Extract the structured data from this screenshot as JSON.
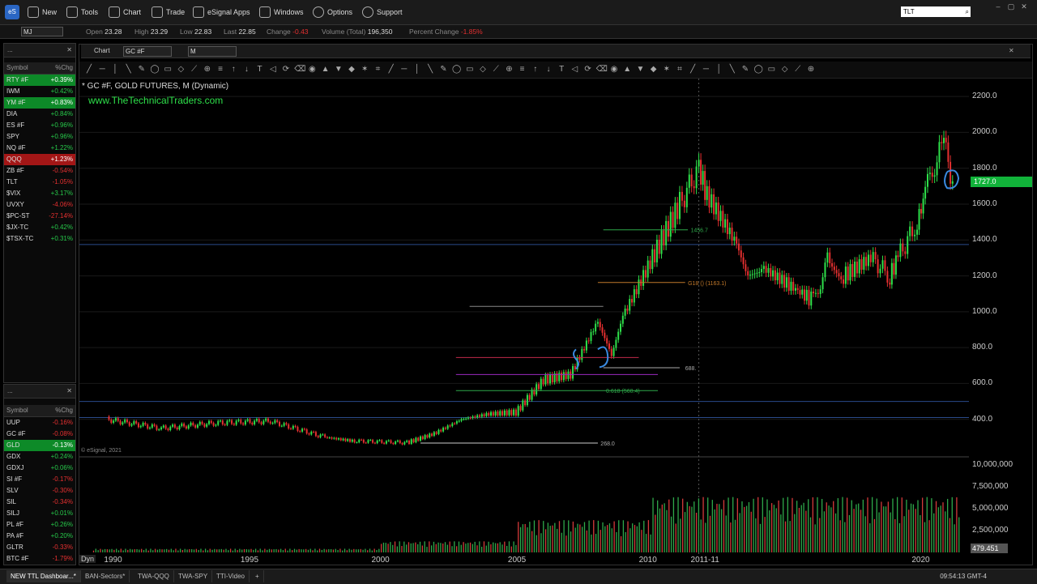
{
  "menu": {
    "logo": "eS",
    "items": [
      {
        "label": "New",
        "icon": "new-window-icon"
      },
      {
        "label": "Tools",
        "icon": "tools-icon"
      },
      {
        "label": "Chart",
        "icon": "chart-icon"
      },
      {
        "label": "Trade",
        "icon": "trade-icon"
      },
      {
        "label": "eSignal Apps",
        "icon": "apps-icon"
      },
      {
        "label": "Windows",
        "icon": "windows-icon"
      },
      {
        "label": "Options",
        "icon": "gear-icon"
      },
      {
        "label": "Support",
        "icon": "help-icon"
      }
    ],
    "search_value": "TLT"
  },
  "quote": {
    "symbol": "MJ",
    "open_label": "Open",
    "open": "23.28",
    "high_label": "High",
    "high": "23.29",
    "low_label": "Low",
    "low": "22.83",
    "last_label": "Last",
    "last": "22.85",
    "change_label": "Change",
    "change": "-0.43",
    "volume_label": "Volume (Total)",
    "volume": "196,350",
    "pct_label": "Percent Change",
    "pct": "-1.85%"
  },
  "watchlist1": {
    "title": "...",
    "col_symbol": "Symbol",
    "col_chg": "%Chg",
    "rows": [
      {
        "s": "RTY #F",
        "c": "+0.39%"
      },
      {
        "s": "IWM",
        "c": "+0.42%"
      },
      {
        "s": "YM #F",
        "c": "+0.83%"
      },
      {
        "s": "DIA",
        "c": "+0.84%"
      },
      {
        "s": "ES #F",
        "c": "+0.96%"
      },
      {
        "s": "SPY",
        "c": "+0.96%"
      },
      {
        "s": "NQ #F",
        "c": "+1.22%"
      },
      {
        "s": "QQQ",
        "c": "+1.23%"
      },
      {
        "s": "ZB #F",
        "c": "-0.54%"
      },
      {
        "s": "TLT",
        "c": "-1.05%"
      },
      {
        "s": "$VIX",
        "c": "+3.17%"
      },
      {
        "s": "UVXY",
        "c": "-4.06%"
      },
      {
        "s": "$PC-ST",
        "c": "-27.14%"
      },
      {
        "s": "$JX-TC",
        "c": "+0.42%"
      },
      {
        "s": "$TSX-TC",
        "c": "+0.31%"
      }
    ]
  },
  "watchlist2": {
    "title": "...",
    "col_symbol": "Symbol",
    "col_chg": "%Chg",
    "rows": [
      {
        "s": "UUP",
        "c": "-0.16%"
      },
      {
        "s": "GC #F",
        "c": "-0.08%"
      },
      {
        "s": "GLD",
        "c": "-0.13%"
      },
      {
        "s": "GDX",
        "c": "+0.24%"
      },
      {
        "s": "GDXJ",
        "c": "+0.06%"
      },
      {
        "s": "SI #F",
        "c": "-0.17%"
      },
      {
        "s": "SLV",
        "c": "-0.30%"
      },
      {
        "s": "SIL",
        "c": "-0.34%"
      },
      {
        "s": "SILJ",
        "c": "+0.01%"
      },
      {
        "s": "PL #F",
        "c": "+0.26%"
      },
      {
        "s": "PA #F",
        "c": "+0.20%"
      },
      {
        "s": "GLTR",
        "c": "-0.33%"
      },
      {
        "s": "BTC #F",
        "c": "-1.79%"
      }
    ]
  },
  "chart": {
    "window_title": "Chart",
    "symbol": "GC #F",
    "interval": "M",
    "info": "* GC #F, GOLD FUTURES, M (Dynamic)",
    "watermark": "www.TheTechnicalTraders.com",
    "copyright": "© eSignal, 2021",
    "last_price_tag": "1727.0",
    "volume_tag": "479.451",
    "dyn_label": "Dyn",
    "fib_labels": {
      "a": "1456.7",
      "b": "G18 () (1163.1)",
      "c": "688.",
      "d": "0.618 (560.4)",
      "e": "268.0"
    }
  },
  "chart_data": {
    "type": "line",
    "title": "* GC #F, GOLD FUTURES, M (Dynamic)",
    "y_ticks": [
      "2200.0",
      "2000.0",
      "1800.0",
      "1600.0",
      "1400.0",
      "1200.0",
      "1000.0",
      "800.0",
      "600.0",
      "400.0"
    ],
    "volume_ticks": [
      "10,000,000",
      "7,500,000",
      "5,000,000",
      "2,500,000"
    ],
    "x_ticks": [
      "1990",
      "1995",
      "2000",
      "2005",
      "2010",
      "2011-11",
      "2020"
    ],
    "ylim": [
      200,
      2300
    ],
    "series": [
      {
        "x": [
          1990,
          1992,
          1994,
          1996,
          1998,
          1999,
          2001,
          2002,
          2003,
          2004,
          2005,
          2006,
          2007,
          2008,
          2008.5,
          2009,
          2010,
          2011,
          2011.7,
          2012,
          2013,
          2013.5,
          2014,
          2015,
          2015.9,
          2016.5,
          2017,
          2018,
          2018.7,
          2019,
          2019.7,
          2020,
          2020.6,
          2021
        ],
        "values": [
          400,
          350,
          380,
          390,
          300,
          280,
          270,
          320,
          400,
          430,
          440,
          620,
          650,
          950,
          750,
          1000,
          1300,
          1600,
          1800,
          1650,
          1400,
          1200,
          1250,
          1150,
          1060,
          1320,
          1200,
          1300,
          1200,
          1300,
          1500,
          1650,
          1970,
          1727
        ]
      }
    ],
    "colors": {
      "up": "#2ee04a",
      "down": "#e53030"
    }
  },
  "taskbar": {
    "tabs": [
      "NEW TTL Dashboar...*",
      "BAN-Sectors*",
      "TWA-QQQ",
      "TWA-SPY",
      "TTI-Video"
    ],
    "clock": "09:54:13 GMT-4"
  }
}
